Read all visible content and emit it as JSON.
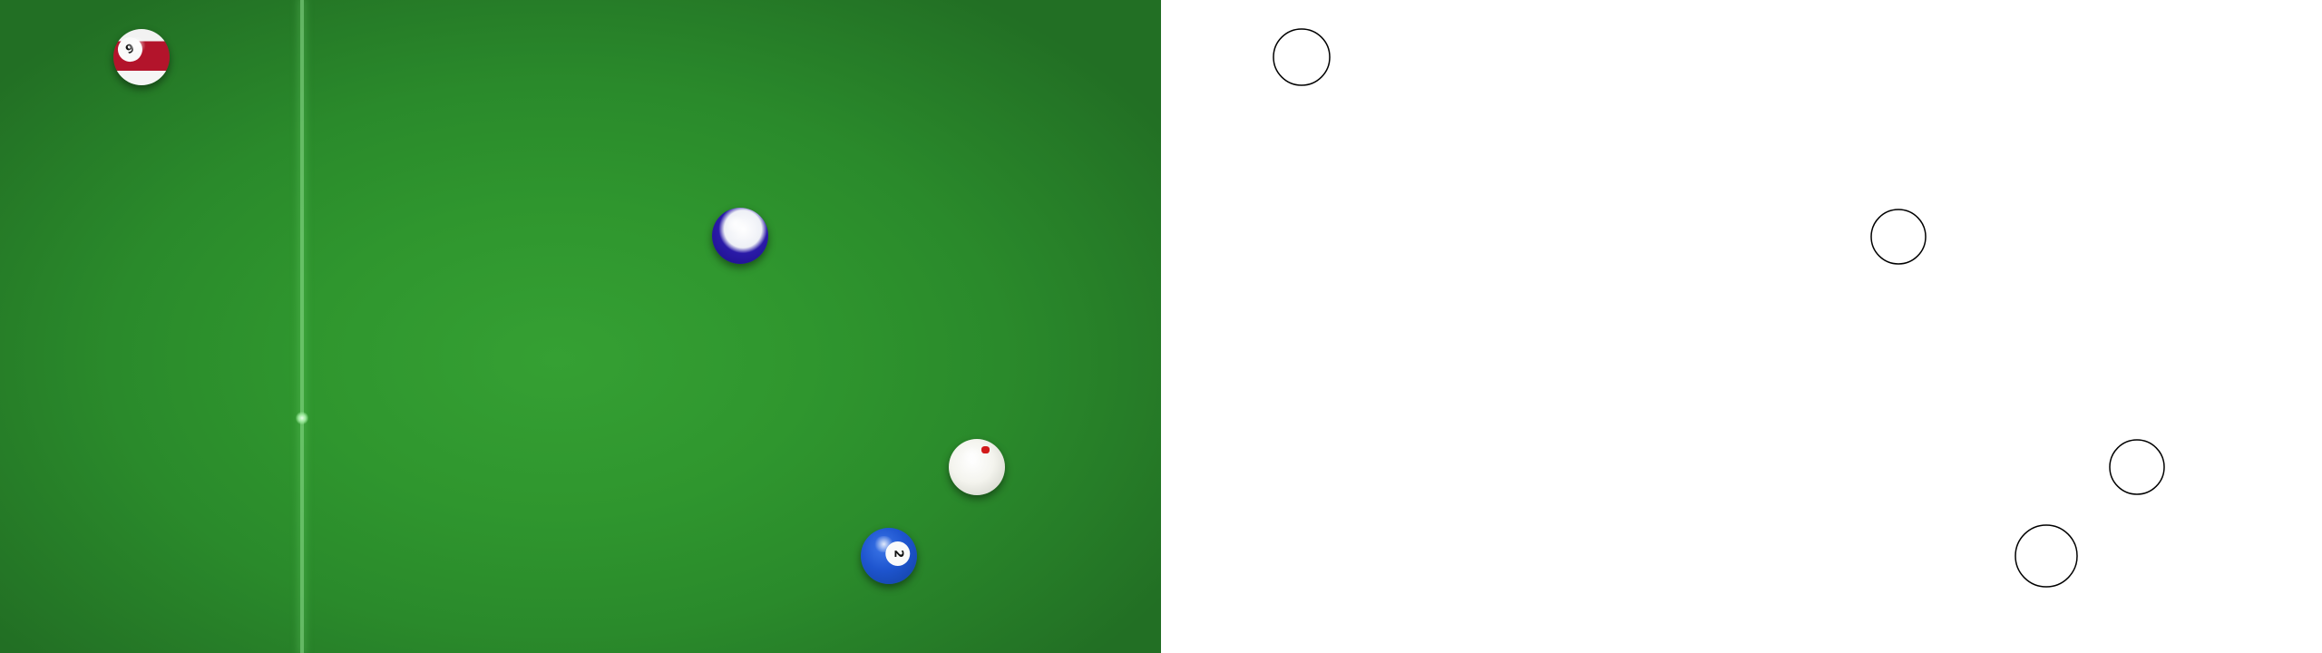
{
  "table": {
    "felt_color": "#2f962e",
    "baulk_line_color": "#9be89b"
  },
  "balls": [
    {
      "id": "stripe-red",
      "type": "stripe",
      "color": "#b3142b",
      "number": "9"
    },
    {
      "id": "stripe-blue",
      "type": "stripe",
      "color": "#2a1aa8",
      "number": ""
    },
    {
      "id": "cue",
      "type": "cue",
      "color": "#f4f4ee",
      "marker_color": "#d21a1a"
    },
    {
      "id": "solid-blue",
      "type": "solid",
      "color": "#1e55cf",
      "number": "2"
    }
  ],
  "outline_panel": {
    "background": "#ffffff",
    "stroke": "#000000",
    "circle_count": 4
  }
}
